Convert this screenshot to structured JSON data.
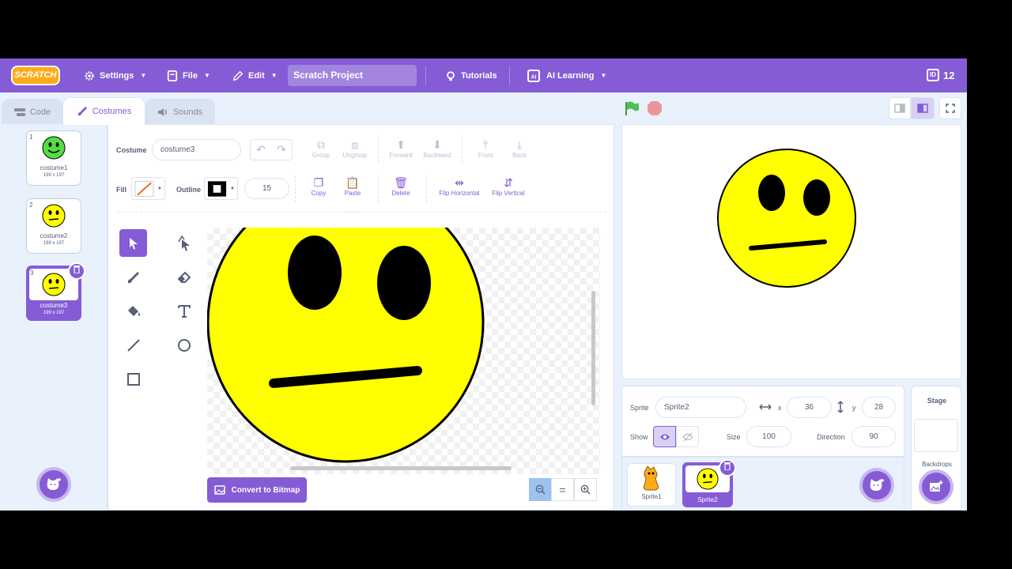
{
  "menubar": {
    "logo": "SCRATCH",
    "settings": "Settings",
    "file": "File",
    "edit": "Edit",
    "project_title": "Scratch Project",
    "tutorials": "Tutorials",
    "ai_learning": "AI Learning",
    "id_badge": "ID",
    "id_value": "12"
  },
  "tabs": {
    "code": "Code",
    "costumes": "Costumes",
    "sounds": "Sounds"
  },
  "costumes": [
    {
      "num": "1",
      "name": "costume1",
      "size": "199 x 197"
    },
    {
      "num": "2",
      "name": "costume2",
      "size": "199 x 197"
    },
    {
      "num": "3",
      "name": "costume3",
      "size": "199 x 197"
    }
  ],
  "editor": {
    "costume_label": "Costume",
    "costume_name": "costume3",
    "group": "Group",
    "ungroup": "Ungroup",
    "forward": "Forward",
    "backward": "Backward",
    "front": "Front",
    "back": "Back",
    "fill_label": "Fill",
    "outline_label": "Outline",
    "outline_width": "15",
    "copy": "Copy",
    "paste": "Paste",
    "delete": "Delete",
    "flip_horizontal": "Flip Horizontal",
    "flip_vertical": "Flip Vertical",
    "convert": "Convert to Bitmap",
    "zoom_reset": "="
  },
  "sprite_info": {
    "sprite_label": "Sprite",
    "sprite_name": "Sprite2",
    "x_label": "x",
    "x_value": "36",
    "y_label": "y",
    "y_value": "28",
    "show_label": "Show",
    "size_label": "Size",
    "size_value": "100",
    "direction_label": "Direction",
    "direction_value": "90"
  },
  "sprites": [
    {
      "name": "Sprite1"
    },
    {
      "name": "Sprite2"
    }
  ],
  "stage_pane": {
    "title": "Stage",
    "backdrops": "Backdrops"
  },
  "colors": {
    "accent": "#855cd6",
    "face": "#ffff00",
    "green_flag": "#4cbf56",
    "stop": "#ec5959"
  }
}
